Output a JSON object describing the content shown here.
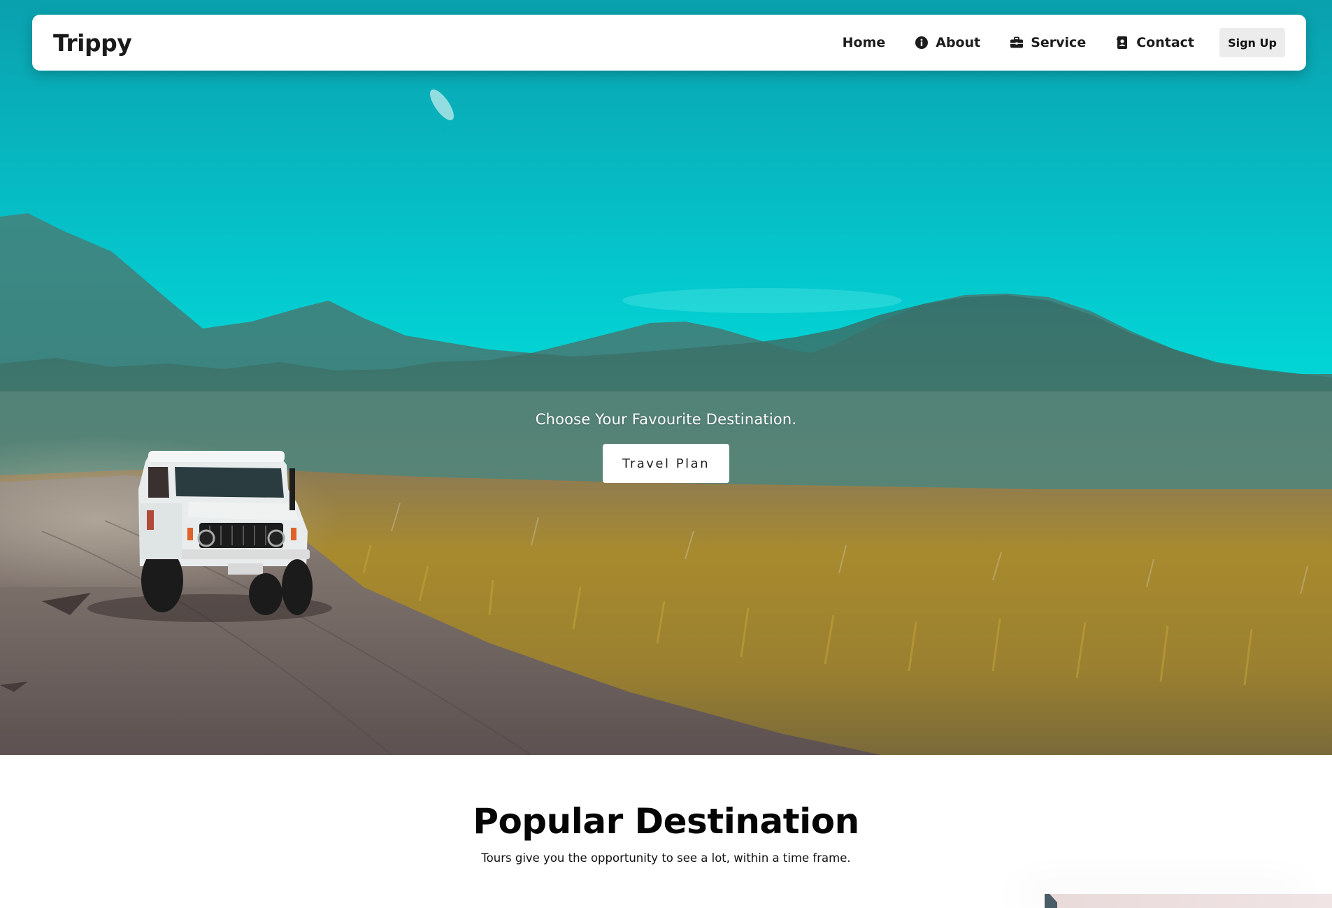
{
  "brand": {
    "logo": "Trippy"
  },
  "nav": {
    "items": [
      {
        "label": "Home",
        "icon": ""
      },
      {
        "label": "About",
        "icon": "info-icon"
      },
      {
        "label": "Service",
        "icon": "briefcase-icon"
      },
      {
        "label": "Contact",
        "icon": "contact-book-icon"
      }
    ],
    "signup_label": "Sign Up"
  },
  "hero": {
    "tagline": "Choose Your Favourite Destination.",
    "button_label": "Travel Plan",
    "image": "hero-landscape-jeep-image"
  },
  "popular": {
    "title": "Popular Destination",
    "subtitle": "Tours give you the opportunity to see a lot, within a time frame."
  },
  "colors": {
    "sky_top": "#0aa3b0",
    "sky_mid": "#00dcdc",
    "mountains": "#2f6d6b",
    "field": "#a88a2e",
    "road": "#6f6262",
    "navbar_bg": "#ffffff",
    "signup_bg": "#ececec"
  }
}
